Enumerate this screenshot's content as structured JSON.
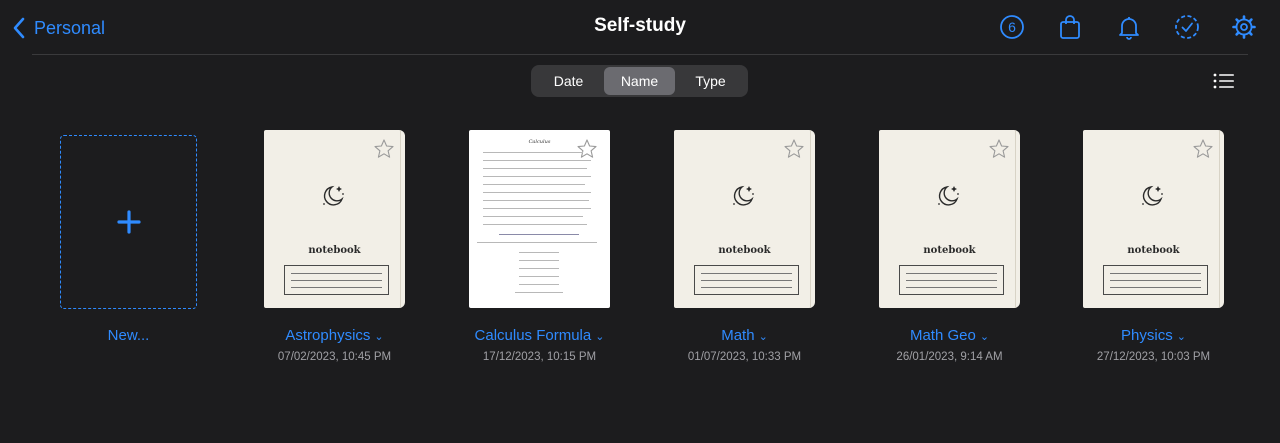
{
  "header": {
    "back_label": "Personal",
    "title": "Self-study",
    "badge_count": "6"
  },
  "icons": {
    "back": "chevron-left-icon",
    "badge": "circle-number-icon",
    "shop": "shopping-bag-icon",
    "notifications": "bell-icon",
    "tasks": "dashed-check-circle-icon",
    "settings": "gear-icon",
    "view": "list-icon",
    "new": "plus-icon",
    "favorite": "star-icon"
  },
  "sort": {
    "options": [
      "Date",
      "Name",
      "Type"
    ],
    "selected": "Name"
  },
  "new_doc": {
    "label": "New..."
  },
  "documents": [
    {
      "name": "Astrophysics",
      "date": "07/02/2023, 10:45 PM",
      "cover": "notebook",
      "cover_title": "notebook"
    },
    {
      "name": "Calculus Formula",
      "date": "17/12/2023, 10:15 PM",
      "cover": "page",
      "cover_title": "Calculus"
    },
    {
      "name": "Math",
      "date": "01/07/2023, 10:33 PM",
      "cover": "notebook",
      "cover_title": "notebook"
    },
    {
      "name": "Math Geo",
      "date": "26/01/2023, 9:14 AM",
      "cover": "notebook",
      "cover_title": "notebook"
    },
    {
      "name": "Physics",
      "date": "27/12/2023, 10:03 PM",
      "cover": "notebook",
      "cover_title": "notebook"
    }
  ],
  "colors": {
    "background": "#1c1c1e",
    "accent": "#2f8bff",
    "secondary_text": "#a0a0a5",
    "segment_bg": "#38383a",
    "segment_active": "#6b6b70"
  }
}
